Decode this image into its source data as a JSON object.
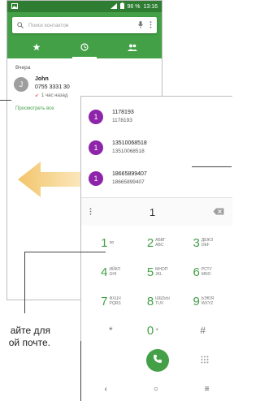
{
  "back_phone": {
    "status_bar": {
      "battery": "96 %",
      "time": "13:16"
    },
    "search": {
      "placeholder": "Поиск контактов"
    },
    "tabs": [
      {
        "icon": "star-icon"
      },
      {
        "icon": "clock-icon",
        "active": true
      },
      {
        "icon": "contacts-icon"
      }
    ],
    "section_label": "Вчера",
    "call_log": [
      {
        "avatar_letter": "J",
        "name": "John",
        "number": "0755 3331 30",
        "time": "1 час назад"
      }
    ],
    "view_more": "Просмотреть все"
  },
  "front_phone": {
    "suggestions": [
      {
        "avatar_letter": "1",
        "name": "1178193",
        "number": "1178193"
      },
      {
        "avatar_letter": "1",
        "name": "13510068518",
        "number": "13510068518"
      },
      {
        "avatar_letter": "1",
        "name": "18665899407",
        "number": "18665899407"
      }
    ],
    "dial_number": "1",
    "keypad": [
      {
        "digit": "1",
        "letters": "∞"
      },
      {
        "digit": "2",
        "letters": "АБВГ ABC"
      },
      {
        "digit": "3",
        "letters": "ДЕЖЗ DEF"
      },
      {
        "digit": "4",
        "letters": "ИЙКЛ GHI"
      },
      {
        "digit": "5",
        "letters": "МНОП JKL"
      },
      {
        "digit": "6",
        "letters": "РСТУ MNO"
      },
      {
        "digit": "7",
        "letters": "ФХЦЧ PQRS"
      },
      {
        "digit": "8",
        "letters": "ШЩЪЫ TUV"
      },
      {
        "digit": "9",
        "letters": "ЬЭЮЯ WXYZ"
      },
      {
        "digit": "*",
        "letters": ""
      },
      {
        "digit": "0",
        "letters": "+"
      },
      {
        "digit": "#",
        "letters": ""
      }
    ],
    "nav": {
      "back": "‹",
      "home": "○",
      "recents": "≡"
    }
  },
  "caption": {
    "line1": "айте для",
    "line2": "ой почте."
  },
  "colors": {
    "accent": "#43a047",
    "status": "#2e7d32",
    "avatar": "#8e24aa",
    "missed": "#e53935"
  }
}
